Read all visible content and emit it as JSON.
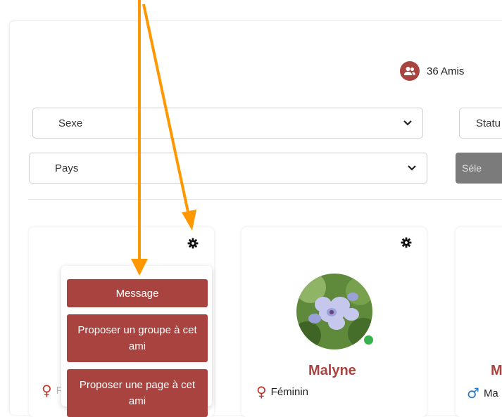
{
  "header": {
    "friends_count": "36 Amis"
  },
  "filters": {
    "sexe": "Sexe",
    "statut": "Statu",
    "pays": "Pays",
    "select_button": "Séle"
  },
  "dropdown": {
    "message": "Message",
    "propose_group": "Proposer un groupe à cet ami",
    "propose_page": "Proposer une page à cet ami"
  },
  "cards": [
    {
      "name": "",
      "gender": "F"
    },
    {
      "name": "Malyne",
      "gender": "Féminin",
      "status": "online"
    },
    {
      "name": "M",
      "gender": "Ma"
    }
  ],
  "colors": {
    "accent": "#a8433f",
    "annotation_arrow": "#ff9800",
    "online": "#37b24d"
  }
}
